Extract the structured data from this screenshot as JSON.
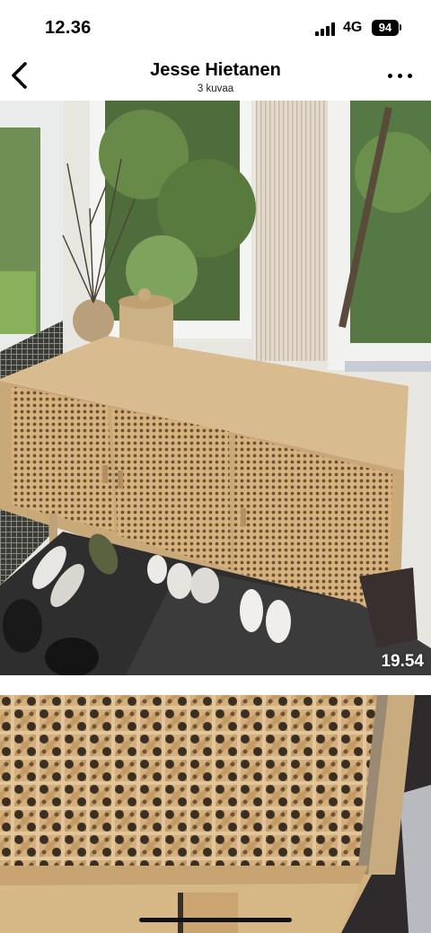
{
  "status_bar": {
    "time": "12.36",
    "network": "4G",
    "battery": "94"
  },
  "nav": {
    "title": "Jesse Hietanen",
    "subtitle": "3 kuvaa",
    "back_icon": "chevron-left-icon",
    "more_icon": "ellipsis-icon"
  },
  "photos": [
    {
      "timestamp": "19.54"
    }
  ],
  "colors": {
    "background": "#ffffff",
    "text": "#000000",
    "rattan": "#d9b684",
    "wood": "#d6b88c"
  }
}
